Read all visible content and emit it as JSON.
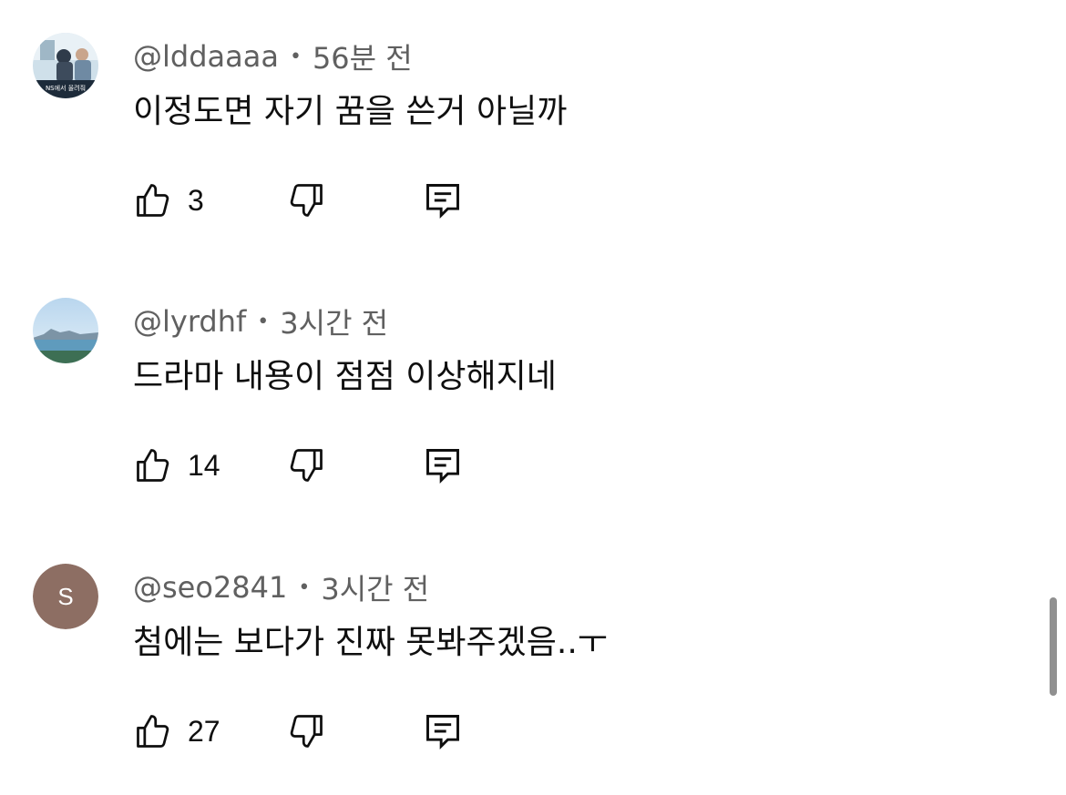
{
  "comments": [
    {
      "author": "@lddaaaa",
      "separator": "•",
      "time": "56분 전",
      "text": "이정도면 자기 꿈을 쓴거 아닐까",
      "likes": "3",
      "avatar_type": "photo",
      "avatar_caption": "NS에서 올려줘"
    },
    {
      "author": "@lyrdhf",
      "separator": "•",
      "time": "3시간 전",
      "text": "드라마 내용이 점점 이상해지네",
      "likes": "14",
      "avatar_type": "photo"
    },
    {
      "author": "@seo2841",
      "separator": "•",
      "time": "3시간 전",
      "text": "첨에는 보다가 진짜 못봐주겠음..ㅜ",
      "likes": "27",
      "avatar_type": "letter",
      "avatar_letter": "S",
      "avatar_color": "#8d6e63"
    }
  ],
  "icons": {
    "like": "thumbs-up-icon",
    "dislike": "thumbs-down-icon",
    "reply": "reply-comment-icon"
  }
}
